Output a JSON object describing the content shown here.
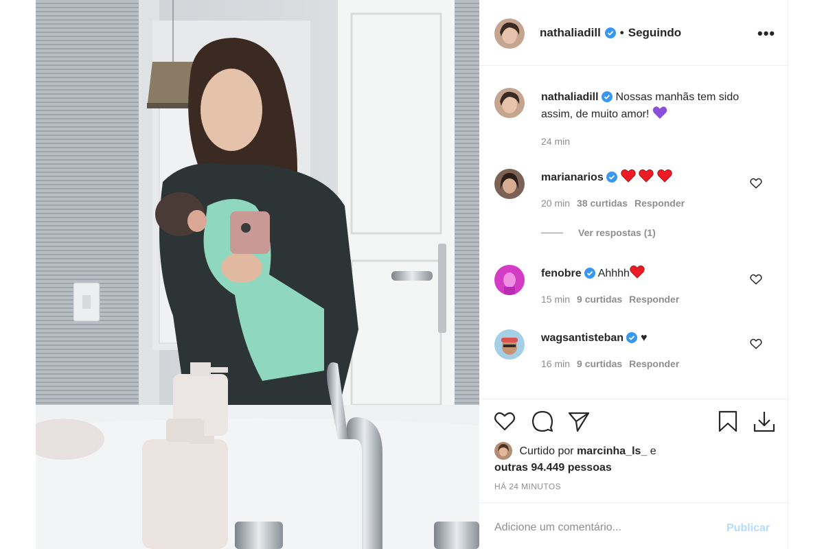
{
  "colors": {
    "accent": "#0095f6",
    "publish_disabled": "#b3dbff",
    "verified": "#3897f0",
    "heart_red": "#ed1c24",
    "purple_heart": "#8a4fd8"
  },
  "header": {
    "username": "nathaliadill",
    "separator": "•",
    "follow_status": "Seguindo",
    "more_icon": "more-horizontal-icon"
  },
  "caption": {
    "username": "nathaliadill",
    "text": "Nossas manhãs tem sido assim, de muito amor!",
    "emoji": "purple-heart",
    "time": "24 min"
  },
  "comments": [
    {
      "username": "marianarios",
      "text": "",
      "emoji": "red-hearts",
      "time": "20 min",
      "likes": "38 curtidas",
      "reply": "Responder",
      "view_replies": "Ver respostas (1)"
    },
    {
      "username": "fenobre",
      "text": "Ahhhh",
      "emoji": "red-heart",
      "time": "15 min",
      "likes": "9 curtidas",
      "reply": "Responder"
    },
    {
      "username": "wagsantisteban",
      "text": "♥",
      "emoji": "black-heart",
      "time": "16 min",
      "likes": "9 curtidas",
      "reply": "Responder"
    }
  ],
  "actions": {
    "icons": [
      "heart-icon",
      "comment-icon",
      "share-icon",
      "bookmark-icon",
      "download-icon"
    ],
    "liked_by_prefix": "Curtido por",
    "liked_by_user": "marcinha_ls_",
    "liked_by_and": "e",
    "liked_by_others": "outras 94.449 pessoas",
    "posted_time": "HÁ 24 MINUTOS"
  },
  "add_comment": {
    "placeholder": "Adicione um comentário...",
    "publish_label": "Publicar"
  }
}
